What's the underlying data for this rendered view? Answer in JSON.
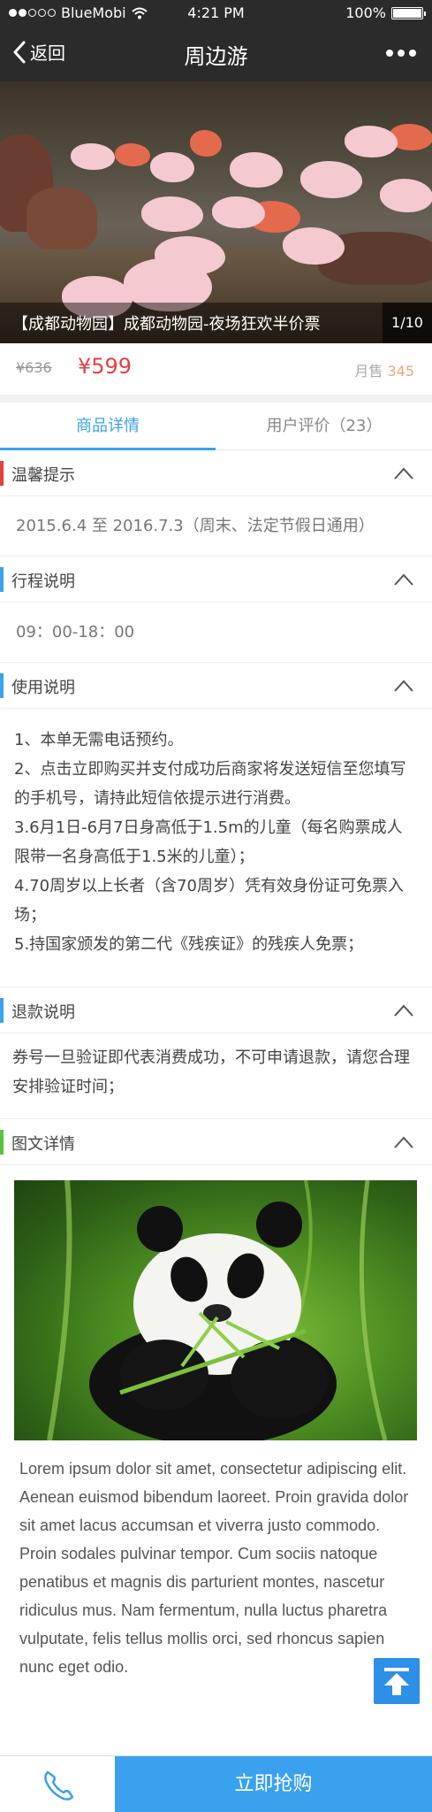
{
  "status_bar": {
    "carrier": "BlueMobi",
    "time": "4:21 PM",
    "battery": "100%"
  },
  "nav": {
    "back_label": "返回",
    "title": "周边游"
  },
  "hero": {
    "caption": "【成都动物园】成都动物园-夜场狂欢半价票",
    "counter": "1/10"
  },
  "price": {
    "original": "¥636",
    "current": "¥599",
    "sold_label": "月售",
    "sold_count": "345"
  },
  "tabs": [
    {
      "label": "商品详情",
      "active": true
    },
    {
      "label": "用户评价（23）",
      "active": false
    }
  ],
  "sections": {
    "tips": {
      "title": "温馨提示",
      "color": "#e5403f",
      "text": "2015.6.4 至 2016.7.3（周末、法定节假日通用）"
    },
    "schedule": {
      "title": "行程说明",
      "color": "#3ba2ee",
      "text": "09：00-18：00"
    },
    "usage": {
      "title": "使用说明",
      "color": "#3ba2ee",
      "lines": [
        "1、本单无需电话预约。",
        "2、点击立即购买并支付成功后商家将发送短信至您填写的手机号，请持此短信依提示进行消费。",
        "3.6月1日-6月7日身高低于1.5m的儿童（每名购票成人限带一名身高低于1.5米的儿童）；",
        "4.70周岁以上长者（含70周岁）凭有效身份证可免票入场；",
        "5.持国家颁发的第二代《残疾证》的残疾人免票；"
      ]
    },
    "refund": {
      "title": "退款说明",
      "color": "#3ba2ee",
      "text": "券号一旦验证即代表消费成功，不可申请退款，请您合理安排验证时间；"
    },
    "gallery": {
      "title": "图文详情",
      "color": "#5cc43a"
    }
  },
  "lorem": "Lorem ipsum dolor sit amet, consectetur adipiscing elit. Aenean euismod bibendum laoreet. Proin gravida dolor sit amet lacus accumsan et viverra justo commodo. Proin sodales pulvinar tempor. Cum sociis natoque penatibus et magnis dis parturient montes, nascetur ridiculus mus. Nam fermentum, nulla luctus pharetra vulputate, felis tellus mollis orci, sed rhoncus sapien nunc eget odio.",
  "footer": {
    "buy_label": "立即抢购"
  },
  "icons": {
    "back": "chevron-left-icon",
    "more": "more-dots-icon",
    "collapse": "chevron-up-icon",
    "to_top": "arrow-to-top-icon",
    "phone": "phone-icon",
    "wifi": "wifi-icon",
    "battery": "battery-icon"
  },
  "colors": {
    "accent": "#3ba2ee",
    "price": "#e5403f",
    "sold": "#f0a37a",
    "dark_bar": "#2b2b2b"
  }
}
